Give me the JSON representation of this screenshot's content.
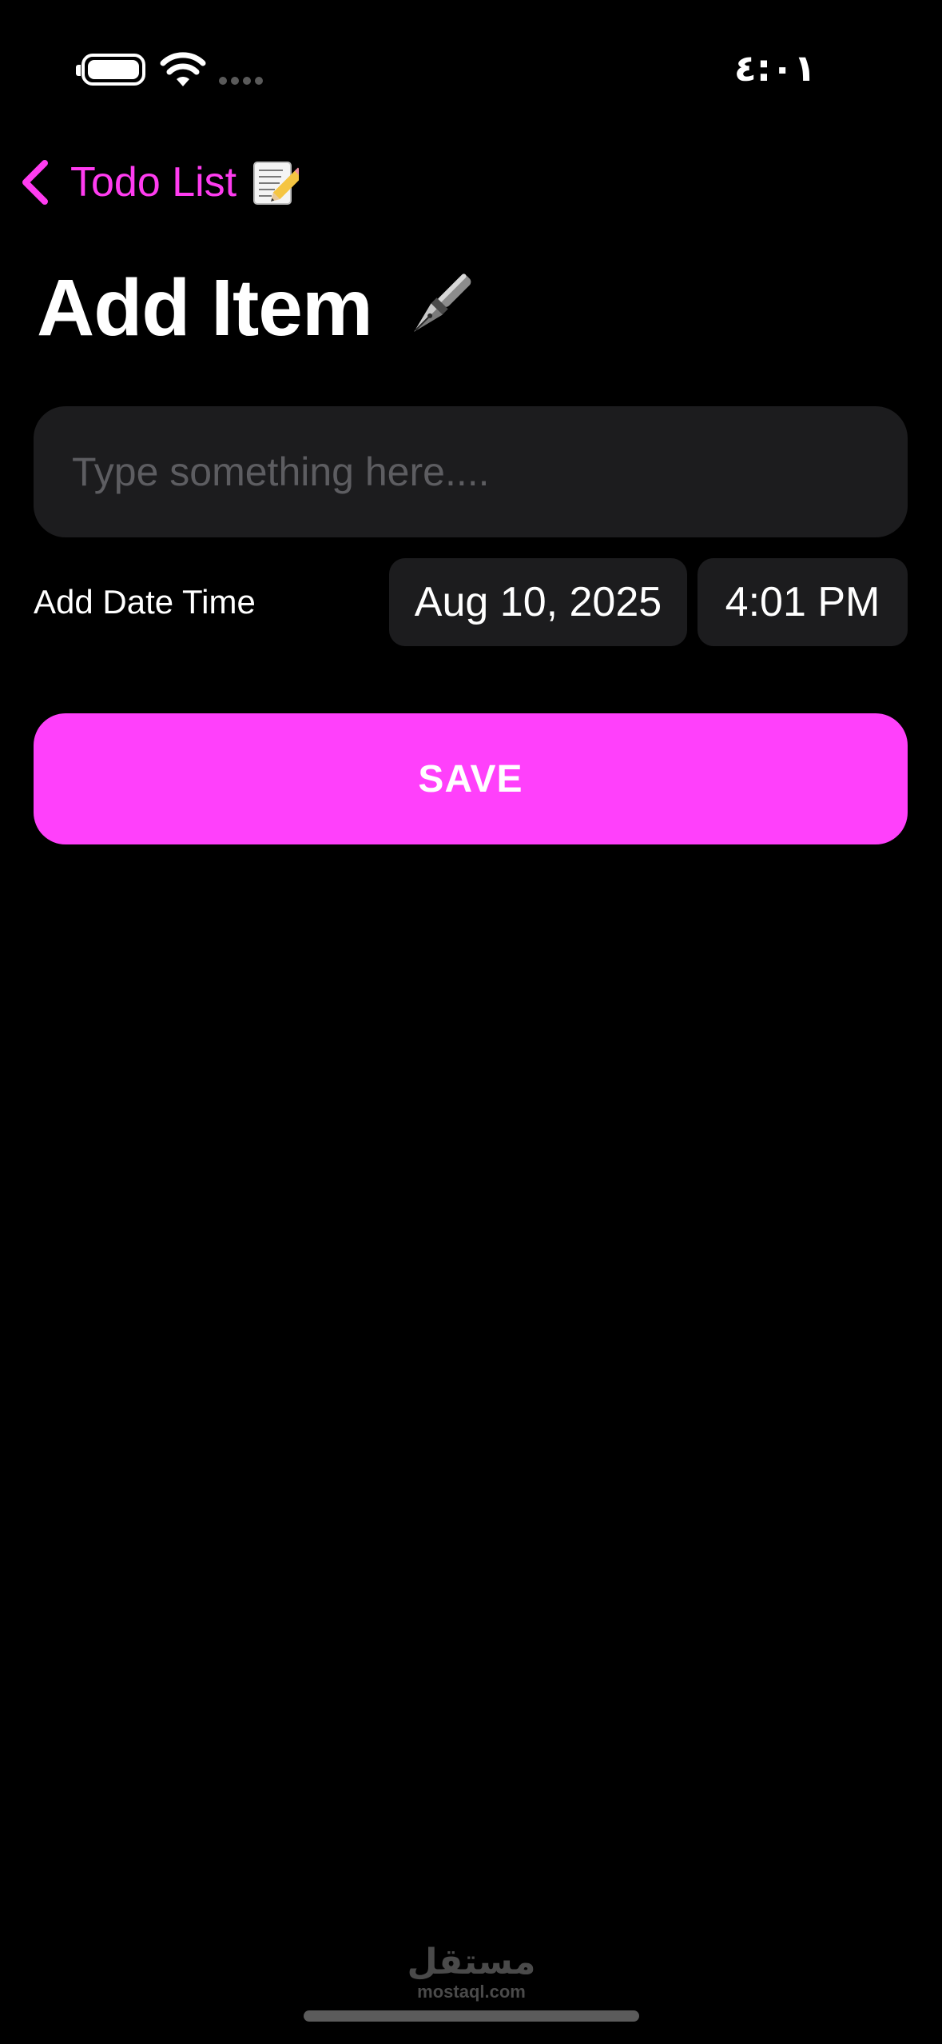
{
  "status_bar": {
    "time": "٤:٠١",
    "battery_icon": "battery-icon",
    "wifi_icon": "wifi-icon",
    "signal_icon": "cellular-signal-icon"
  },
  "nav": {
    "back_label": "Todo List",
    "back_icon": "chevron-left-icon",
    "back_emoji": "memo-emoji"
  },
  "page": {
    "title": "Add Item",
    "title_emoji": "fountain-pen-emoji"
  },
  "form": {
    "item_value": "",
    "item_placeholder": "Type something here....",
    "date_time_label": "Add Date Time",
    "date_value": "Aug 10, 2025",
    "time_value": "4:01 PM",
    "save_label": "SAVE"
  },
  "watermark": {
    "logo_text": "مستقل",
    "url": "mostaql.com"
  },
  "colors": {
    "accent": "#ff40fb",
    "background": "#000000",
    "field_background": "#1c1c1e",
    "placeholder": "#5d5d61"
  }
}
